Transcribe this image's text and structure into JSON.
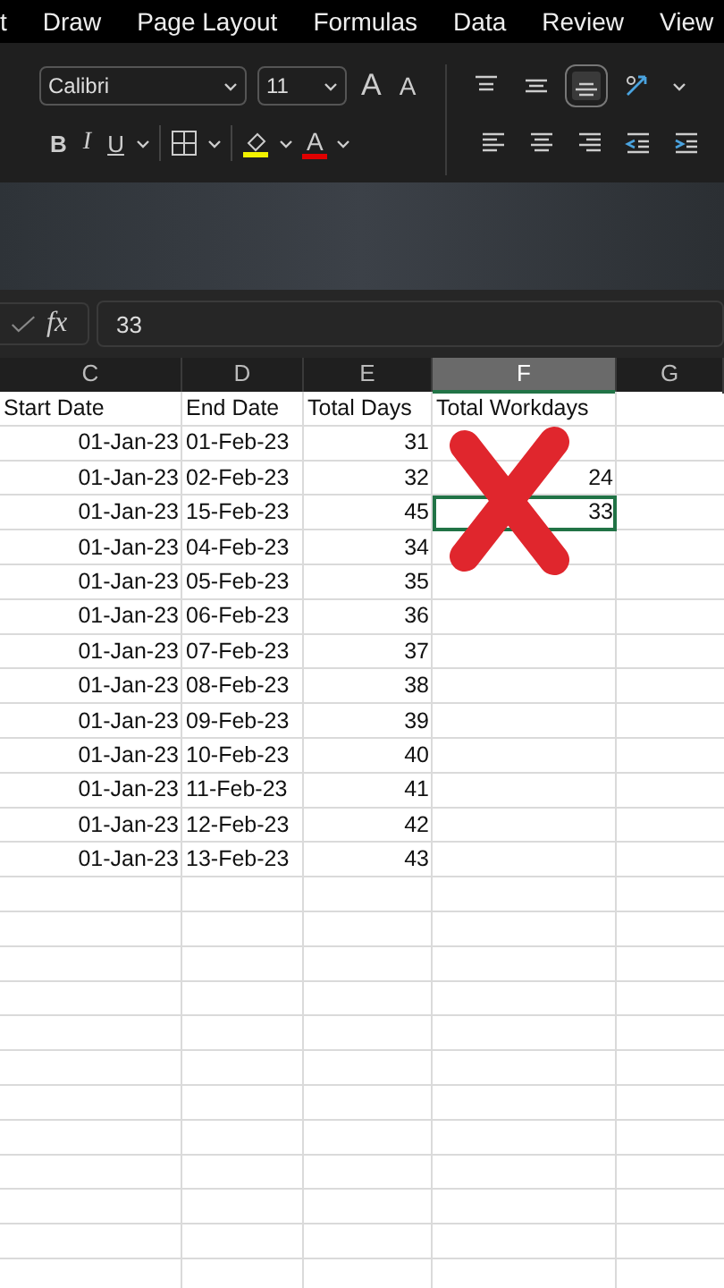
{
  "menu_tabs": [
    {
      "label": "t"
    },
    {
      "label": "Draw"
    },
    {
      "label": "Page Layout"
    },
    {
      "label": "Formulas"
    },
    {
      "label": "Data"
    },
    {
      "label": "Review"
    },
    {
      "label": "View"
    }
  ],
  "ribbon": {
    "font_name": "Calibri",
    "font_size": "11",
    "grow_font": "A",
    "shrink_font": "A",
    "bold": "B",
    "italic": "I",
    "underline": "U",
    "font_color": "A",
    "bottom_align_selected": true
  },
  "formula_bar": {
    "function_label": "fx",
    "value": "33"
  },
  "columns": [
    {
      "label": "C",
      "selected": false
    },
    {
      "label": "D",
      "selected": false
    },
    {
      "label": "E",
      "selected": false
    },
    {
      "label": "F",
      "selected": true
    },
    {
      "label": "G",
      "selected": false
    }
  ],
  "rows": [
    {
      "cells": [
        "Start Date",
        "End Date",
        "Total Days",
        "Total Workdays"
      ],
      "kind": "header",
      "f_selected": false
    },
    {
      "cells": [
        "01-Jan-23",
        "01-Feb-23",
        "31",
        ""
      ],
      "kind": "data",
      "f_selected": false
    },
    {
      "cells": [
        "01-Jan-23",
        "02-Feb-23",
        "32",
        "24"
      ],
      "kind": "data",
      "f_selected": false
    },
    {
      "cells": [
        "01-Jan-23",
        "15-Feb-23",
        "45",
        "33"
      ],
      "kind": "data",
      "f_selected": true
    },
    {
      "cells": [
        "01-Jan-23",
        "04-Feb-23",
        "34",
        ""
      ],
      "kind": "data",
      "f_selected": false
    },
    {
      "cells": [
        "01-Jan-23",
        "05-Feb-23",
        "35",
        ""
      ],
      "kind": "data",
      "f_selected": false
    },
    {
      "cells": [
        "01-Jan-23",
        "06-Feb-23",
        "36",
        ""
      ],
      "kind": "data",
      "f_selected": false
    },
    {
      "cells": [
        "01-Jan-23",
        "07-Feb-23",
        "37",
        ""
      ],
      "kind": "data",
      "f_selected": false
    },
    {
      "cells": [
        "01-Jan-23",
        "08-Feb-23",
        "38",
        ""
      ],
      "kind": "data",
      "f_selected": false
    },
    {
      "cells": [
        "01-Jan-23",
        "09-Feb-23",
        "39",
        ""
      ],
      "kind": "data",
      "f_selected": false
    },
    {
      "cells": [
        "01-Jan-23",
        "10-Feb-23",
        "40",
        ""
      ],
      "kind": "data",
      "f_selected": false
    },
    {
      "cells": [
        "01-Jan-23",
        "11-Feb-23",
        "41",
        ""
      ],
      "kind": "data",
      "f_selected": false
    },
    {
      "cells": [
        "01-Jan-23",
        "12-Feb-23",
        "42",
        ""
      ],
      "kind": "data",
      "f_selected": false
    },
    {
      "cells": [
        "01-Jan-23",
        "13-Feb-23",
        "43",
        ""
      ],
      "kind": "data",
      "f_selected": false
    }
  ]
}
